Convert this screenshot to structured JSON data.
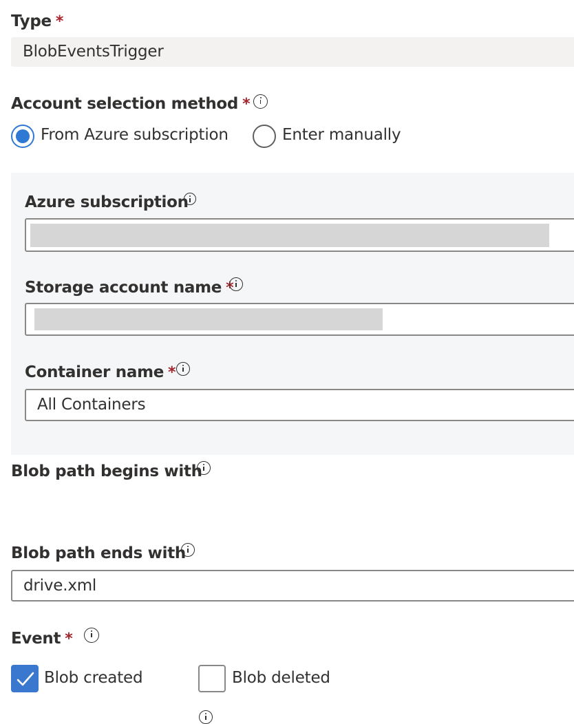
{
  "type_field": {
    "label": "Type",
    "required_mark": "*",
    "value": "BlobEventsTrigger"
  },
  "account_selection": {
    "label": "Account selection method",
    "required_mark": "*",
    "info_icon": "info-icon",
    "options": [
      {
        "label": "From Azure subscription",
        "selected": true
      },
      {
        "label": "Enter manually",
        "selected": false
      }
    ]
  },
  "subscription_panel": {
    "azure_subscription": {
      "label": "Azure subscription",
      "info_icon": "info-icon",
      "value": "",
      "redacted": true
    },
    "storage_account": {
      "label": "Storage account name",
      "required_mark": "*",
      "info_icon": "info-icon",
      "value": "",
      "redacted": true
    },
    "container": {
      "label": "Container name",
      "required_mark": "*",
      "info_icon": "info-icon",
      "value": "All Containers"
    }
  },
  "blob_path_begins": {
    "label": "Blob path begins with",
    "info_icon": "info-icon",
    "value": ""
  },
  "blob_path_ends": {
    "label": "Blob path ends with",
    "info_icon": "info-icon",
    "value": "drive.xml"
  },
  "event": {
    "label": "Event",
    "required_mark": "*",
    "info_icon": "info-icon",
    "options": [
      {
        "label": "Blob created",
        "checked": true
      },
      {
        "label": "Blob deleted",
        "checked": false
      }
    ]
  },
  "colors": {
    "accent": "#2f78d4",
    "checkbox_accent": "#3a78d0",
    "required": "#a4262c",
    "readonly_bg": "#f3f2f1",
    "panel_bg": "#f5f6f8",
    "input_border": "#8a8886",
    "text": "#323130"
  }
}
